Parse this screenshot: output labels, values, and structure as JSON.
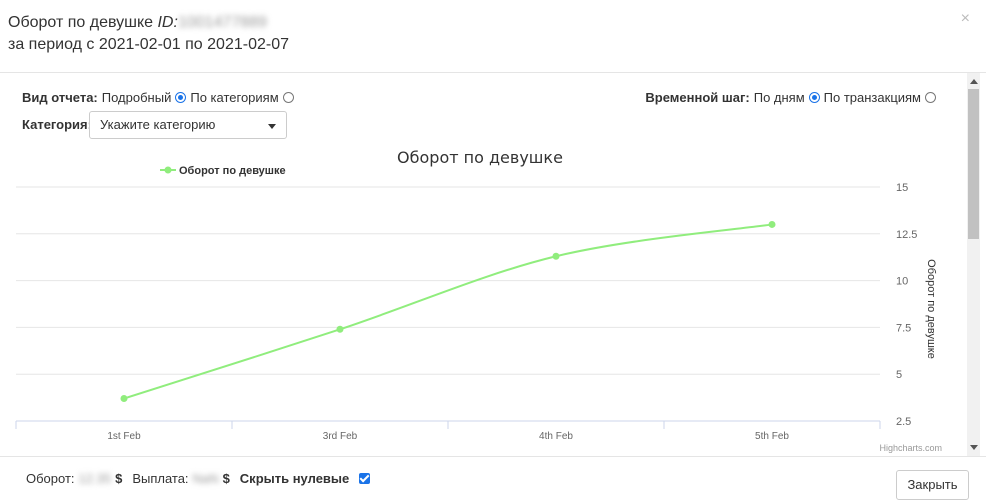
{
  "header": {
    "title_prefix": "Оборот по девушке",
    "id_label": "ID:",
    "id_value": "1001477889",
    "period": "за период с 2021-02-01 по 2021-02-07",
    "close_glyph": "×"
  },
  "controls": {
    "report_type_label": "Вид отчета:",
    "report_opt1": "Подробный",
    "report_opt2": "По категориям",
    "category_label": "Категория:",
    "category_placeholder": "Укажите категорию",
    "timestep_label": "Временной шаг:",
    "timestep_opt1": "По дням",
    "timestep_opt2": "По транзакциям"
  },
  "chart_data": {
    "type": "line",
    "title": "Оборот по девушке",
    "categories": [
      "1st Feb",
      "3rd Feb",
      "4th Feb",
      "5th Feb"
    ],
    "series": [
      {
        "name": "Оборот по девушке",
        "values": [
          3.7,
          7.4,
          11.3,
          13.0
        ],
        "color": "#90ed7d"
      }
    ],
    "ylabel": "Оборот по девушке",
    "yticks": [
      2.5,
      5,
      7.5,
      10,
      12.5,
      15
    ],
    "ylim": [
      2.5,
      15
    ],
    "credit": "Highcharts.com",
    "legend_position": "top-left"
  },
  "footer": {
    "turnover_label": "Оборот:",
    "turnover_value": "12.35",
    "payout_label": "Выплата:",
    "payout_value": "NaN",
    "currency": "$",
    "hide_zero_label": "Скрыть нулевые",
    "close_button": "Закрыть"
  }
}
